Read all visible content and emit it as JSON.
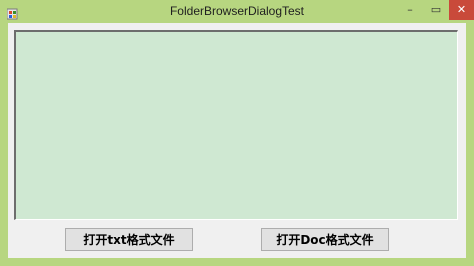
{
  "window": {
    "title": "FolderBrowserDialogTest",
    "controls": {
      "minimize": "–",
      "maximize": "▭",
      "close": "✕"
    }
  },
  "buttons": {
    "open_txt": "打开txt格式文件",
    "open_doc": "打开Doc格式文件"
  },
  "colors": {
    "frame": "#b7d680",
    "textarea_bg": "#cfe8d2",
    "client_bg": "#f0f0f0"
  }
}
